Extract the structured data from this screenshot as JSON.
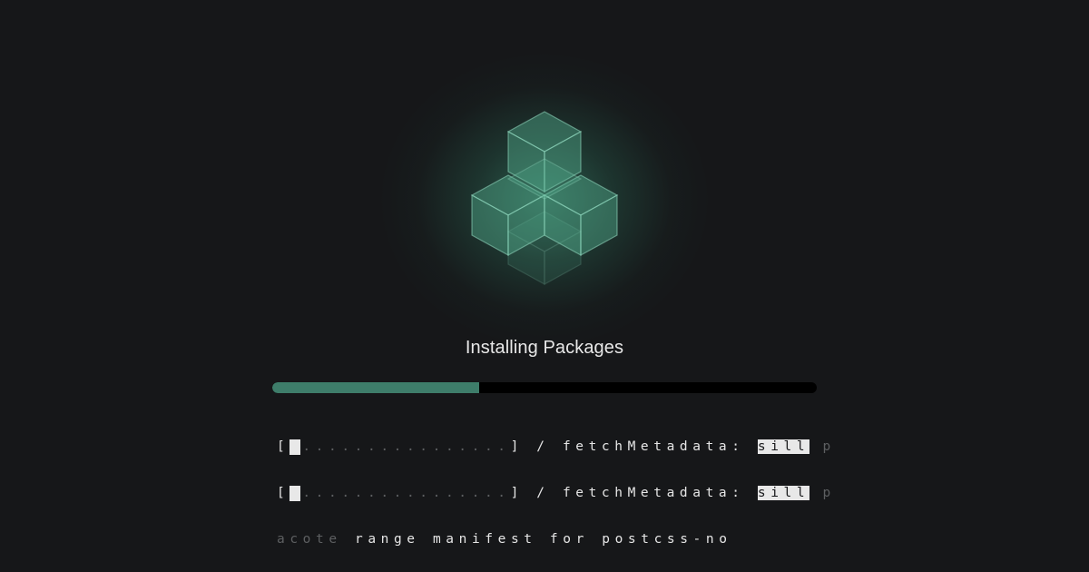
{
  "logo": {
    "icon": "stacked-cubes-icon",
    "accent_color": "#3e7d6a"
  },
  "title": "Installing Packages",
  "progress": {
    "value": 0.38,
    "fill_color": "#3e7d6a",
    "track_color": "#000000"
  },
  "terminal": {
    "line1": {
      "open": "[",
      "dots": "................",
      "rest": "] / fetchMetadata: ",
      "highlight": "sill",
      "tail": " p"
    },
    "line2": {
      "open": "[",
      "dots": "................",
      "rest": "] / fetchMetadata: ",
      "highlight": "sill",
      "tail": " p"
    },
    "line3": {
      "dim": "acote",
      "rest": " range manifest for postcss-no"
    }
  }
}
